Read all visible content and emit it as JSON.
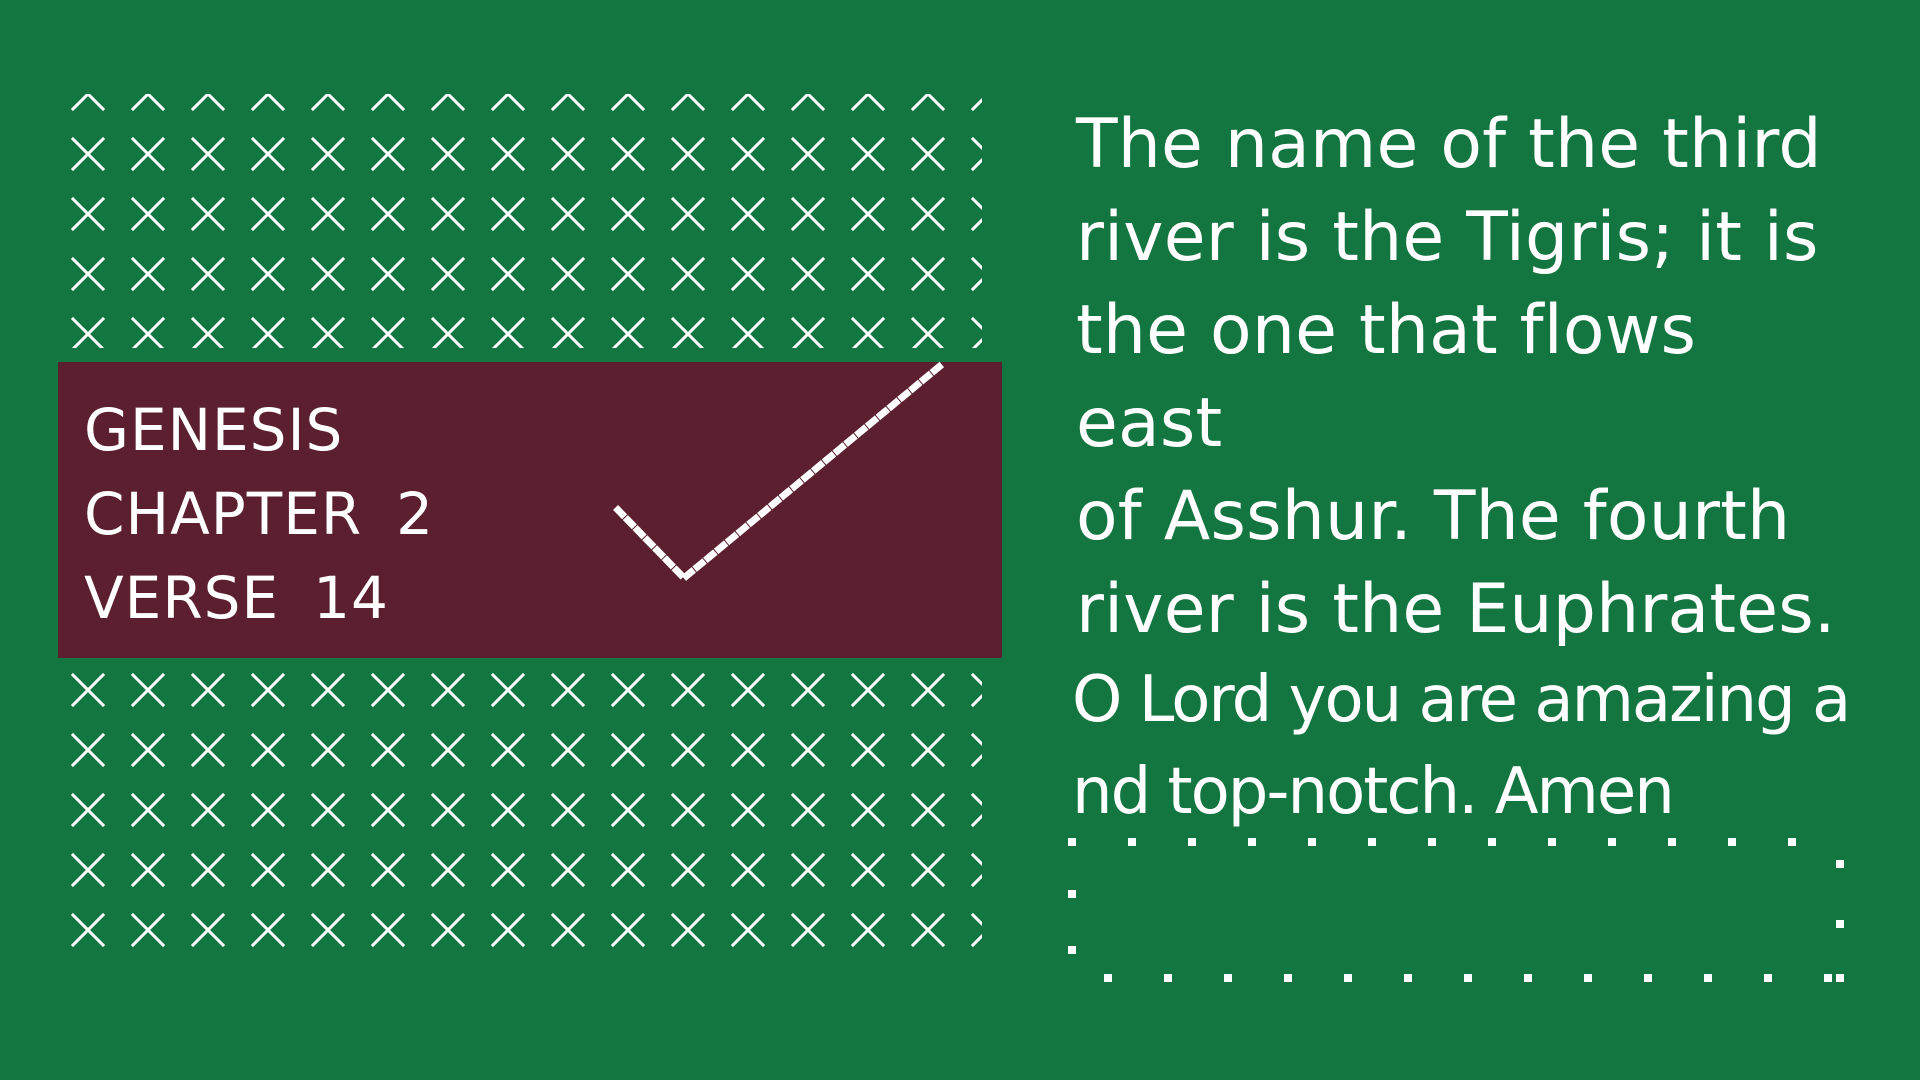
{
  "reference": {
    "book": "GENESIS",
    "chapter_label": "CHAPTER",
    "chapter_number": "2",
    "verse_label": "VERSE",
    "verse_number": "14"
  },
  "verse": {
    "lines": [
      "The name of the third",
      "river is the Tigris; it is",
      "the one that flows east",
      "of Asshur. The fourth",
      "river is the Euphrates."
    ]
  },
  "prayer": {
    "lines": [
      "O Lord you are amazing a",
      "nd top-notch. Amen"
    ]
  },
  "icons": {
    "pattern": "x-pattern-icon",
    "check": "check-mark-icon"
  },
  "colors": {
    "background": "#137640",
    "reference_box": "#5b1f30",
    "text": "#ffffff",
    "pattern": "#ffffff"
  }
}
